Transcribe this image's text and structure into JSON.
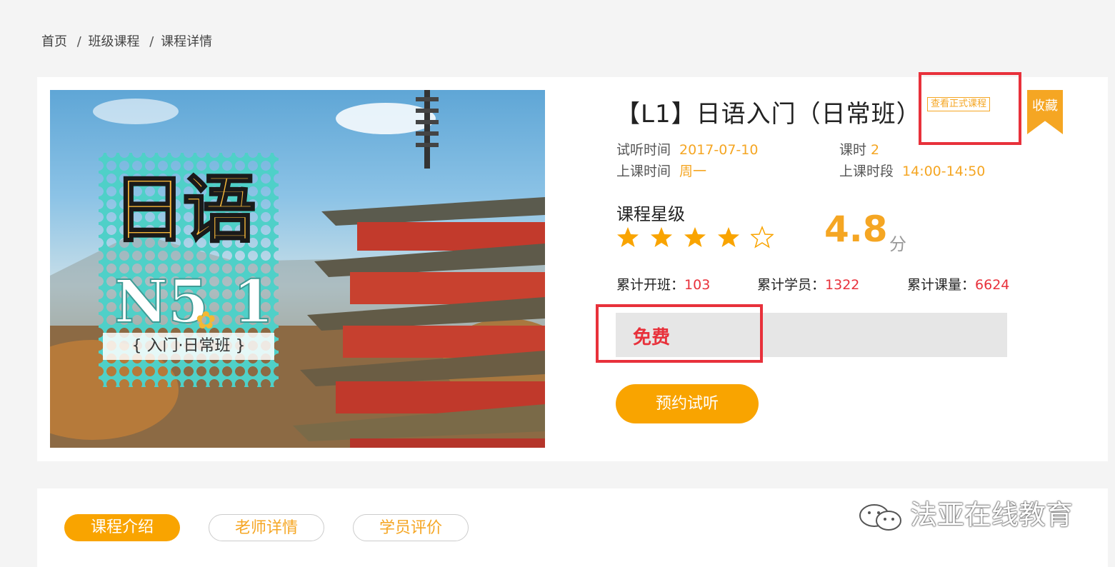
{
  "breadcrumb": {
    "home": "首页",
    "sep": "/",
    "classes": "班级课程",
    "detail": "课程详情"
  },
  "hero": {
    "stamp_title": "日语",
    "stamp_level_a": "N5",
    "stamp_level_b": "1",
    "stamp_subtitle": "{ 入门·日常班 }"
  },
  "course": {
    "title": "【L1】日语入门（日常班）",
    "formal_link": "查看正式课程",
    "favorite": "收藏",
    "trial_time_label": "试听时间",
    "trial_time": "2017-07-10",
    "hours_label": "课时",
    "hours": "2",
    "class_day_label": "上课时间",
    "class_day": "周一",
    "class_slot_label": "上课时段",
    "class_slot": "14:00-14:50",
    "rating_label": "课程星级",
    "rating": "4.8",
    "rating_unit": "分",
    "stars_filled": 4,
    "stars_total": 5,
    "stats": {
      "classes_label": "累计开班：",
      "classes": "103",
      "students_label": "累计学员：",
      "students": "1322",
      "lessons_label": "累计课量：",
      "lessons": "6624"
    },
    "price": "免费",
    "book_button": "预约试听"
  },
  "tabs": [
    "课程介绍",
    "老师详情",
    "学员评价"
  ],
  "watermark": "法亚在线教育",
  "colors": {
    "accent": "#f9a400",
    "price_red": "#e8313b",
    "highlight_box": "#e8313b"
  }
}
